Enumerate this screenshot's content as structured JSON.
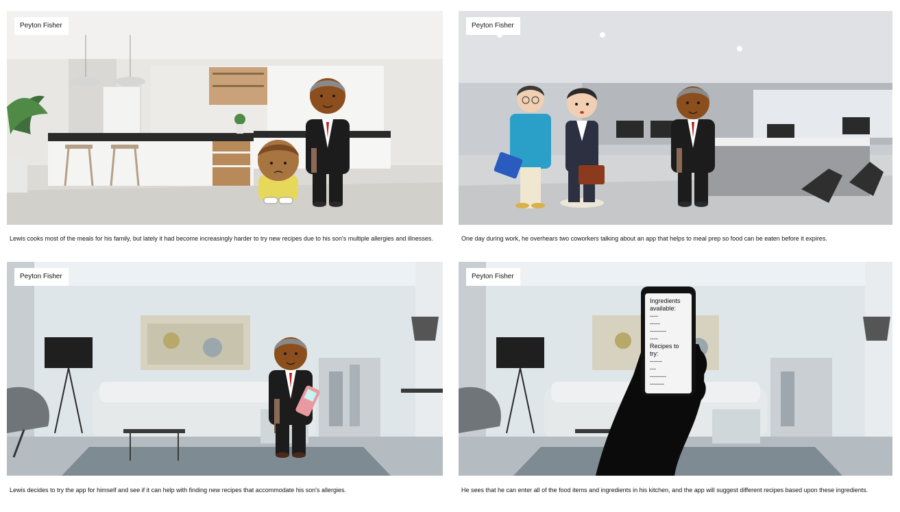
{
  "panels": [
    {
      "name_tag": "Peyton Fisher",
      "caption": "Lewis cooks most of the meals for his family, but lately it had become increasingly harder to try new recipes due to his son's multiple allergies and illnesses."
    },
    {
      "name_tag": "Peyton Fisher",
      "caption": "One day during work, he overhears two coworkers talking about an app that helps to meal prep so food can be eaten before it expires."
    },
    {
      "name_tag": "Peyton Fisher",
      "caption": "Lewis decides to try the app for himself and see if it can help with finding new recipes that accommodate his son's allergies."
    },
    {
      "name_tag": "Peyton Fisher",
      "caption": "He sees that he can enter all of the food items and ingredients in his kitchen, and the app will suggest different recipes based upon these ingredients."
    }
  ],
  "phone_screen": {
    "lines": [
      "Ingredients",
      "available:",
      "----",
      "-----",
      "--------",
      "----",
      "Recipes to",
      "try:",
      "------",
      "---",
      "--------",
      "-------"
    ]
  }
}
